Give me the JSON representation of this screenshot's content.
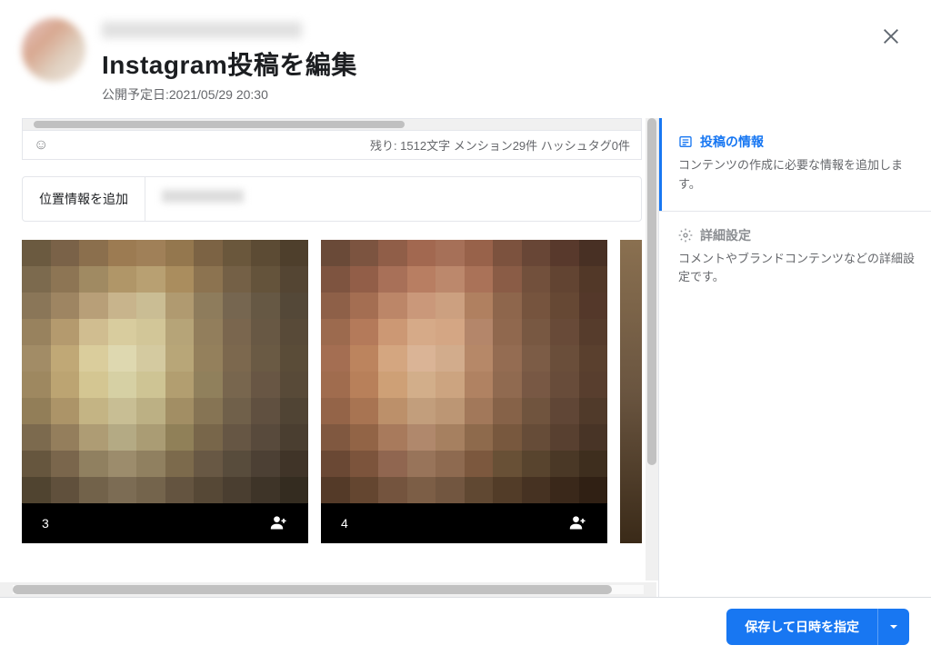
{
  "header": {
    "title": "Instagram投稿を編集",
    "schedule_label": "公開予定日:",
    "schedule_value": "2021/05/29 20:30"
  },
  "counter": {
    "text": "残り: 1512文字 メンション29件 ハッシュタグ0件"
  },
  "location": {
    "label": "位置情報を追加"
  },
  "images": [
    {
      "badge": "3"
    },
    {
      "badge": "4"
    }
  ],
  "sidebar": {
    "info": {
      "title": "投稿の情報",
      "desc": "コンテンツの作成に必要な情報を追加します。"
    },
    "advanced": {
      "title": "詳細設定",
      "desc": "コメントやブランドコンテンツなどの詳細設定です。"
    }
  },
  "footer": {
    "primary_label": "保存して日時を指定"
  },
  "mosaic_palettes": [
    [
      "#6b5a40",
      "#7a6248",
      "#8b6f4d",
      "#9c7b52",
      "#a08058",
      "#94774e",
      "#7c6344",
      "#6a573c",
      "#5c4b34",
      "#4e3f2c",
      "#7c6a4e",
      "#8d7554",
      "#a08a62",
      "#b09668",
      "#b8a072",
      "#aa8d5e",
      "#8c7350",
      "#746046",
      "#64533b",
      "#544533",
      "#8a7658",
      "#9e8562",
      "#b89f78",
      "#c8b48c",
      "#cabd94",
      "#b09a70",
      "#8e7c5c",
      "#766650",
      "#665844",
      "#544838",
      "#98825e",
      "#b49a6e",
      "#d0bd90",
      "#d8cc9e",
      "#d2c698",
      "#b6a478",
      "#927e5c",
      "#7a664e",
      "#685844",
      "#584a38",
      "#a28c66",
      "#c0a876",
      "#dacd9c",
      "#ded8b0",
      "#d4caa0",
      "#b8a678",
      "#94805c",
      "#7c684e",
      "#6a5a44",
      "#5a4c38",
      "#9e8860",
      "#bca472",
      "#d4c692",
      "#d6d0a4",
      "#cec494",
      "#b29e70",
      "#90805c",
      "#78664e",
      "#685644",
      "#584a38",
      "#927e58",
      "#ac9468",
      "#c4b484",
      "#c8be94",
      "#bcb084",
      "#a28e64",
      "#867454",
      "#70604a",
      "#605040",
      "#504434",
      "#7c6a4e",
      "#947e5c",
      "#ae9c74",
      "#b4aa84",
      "#aa9c74",
      "#908058",
      "#78664a",
      "#665644",
      "#584a3c",
      "#4a3e30",
      "#66563e",
      "#7a664c",
      "#908060",
      "#9c8c6c",
      "#908060",
      "#7c6a4c",
      "#685844",
      "#584c3c",
      "#4c4034",
      "#403428",
      "#504430",
      "#60503c",
      "#72624a",
      "#7c6c54",
      "#74644c",
      "#645440",
      "#564836",
      "#4a3e30",
      "#3e3428",
      "#342c20"
    ],
    [
      "#6a4a38",
      "#7c5440",
      "#905e48",
      "#a26850",
      "#a67058",
      "#98624a",
      "#7c523e",
      "#684636",
      "#58392c",
      "#483024",
      "#7e5440",
      "#925e48",
      "#a87058",
      "#b87e62",
      "#bc886c",
      "#aa7258",
      "#8a5c46",
      "#72503c",
      "#624432",
      "#523828",
      "#8e6048",
      "#a46e52",
      "#bc8668",
      "#ca987a",
      "#cca080",
      "#b08060",
      "#8e664c",
      "#76543e",
      "#664834",
      "#54382a",
      "#9c6a4e",
      "#b47a5a",
      "#cc9874",
      "#d6aa88",
      "#d4a684",
      "#b4866a",
      "#90684e",
      "#785842",
      "#684a38",
      "#563c2c",
      "#a46e52",
      "#bc845e",
      "#d4a680",
      "#dab496",
      "#d2ac8c",
      "#b68868",
      "#946c52",
      "#7c5c46",
      "#6a4e3a",
      "#5a402e",
      "#a06c4e",
      "#b8805a",
      "#cea076",
      "#d2ae8a",
      "#cca480",
      "#b08262",
      "#906a50",
      "#785844",
      "#684c3a",
      "#583e2e",
      "#946448",
      "#a87452",
      "#bc906a",
      "#c29e7c",
      "#bc9674",
      "#a2785a",
      "#866248",
      "#70543e",
      "#604636",
      "#503a2a",
      "#805840",
      "#926446",
      "#a87a5c",
      "#b0886c",
      "#a68060",
      "#8e6a4c",
      "#78583e",
      "#664c38",
      "#584030",
      "#483426",
      "#6a4834",
      "#7c543c",
      "#906650",
      "#98745a",
      "#8e6a50",
      "#7c583e",
      "#685036",
      "#58442e",
      "#4a3826",
      "#3e2e1e",
      "#543a28",
      "#644630",
      "#74543e",
      "#7c5e46",
      "#725640",
      "#604832",
      "#523c28",
      "#463222",
      "#3a281a",
      "#302014"
    ]
  ]
}
